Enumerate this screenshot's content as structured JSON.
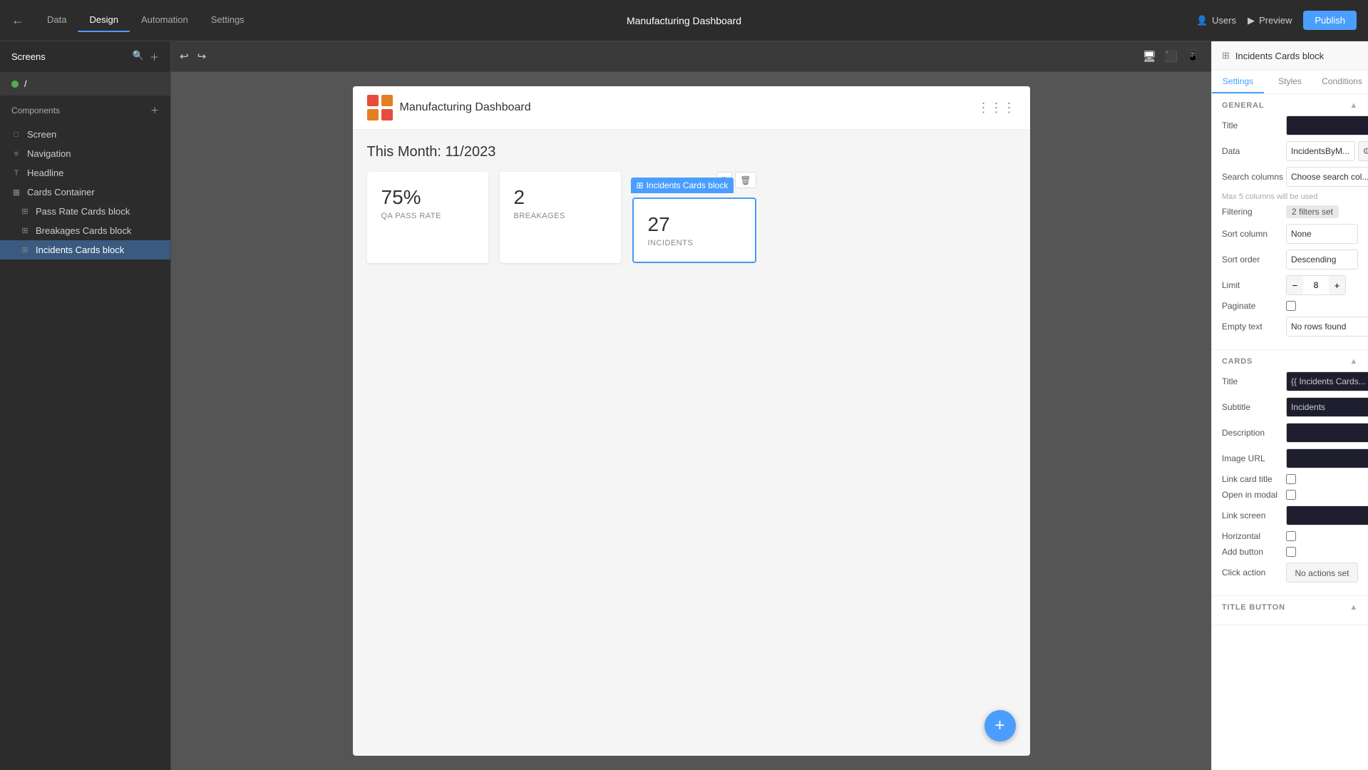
{
  "topNav": {
    "backLabel": "←",
    "tabs": [
      "Data",
      "Design",
      "Automation",
      "Settings"
    ],
    "activeTab": "Design",
    "appTitle": "Manufacturing Dashboard",
    "rightActions": {
      "users": "Users",
      "preview": "Preview",
      "publish": "Publish"
    }
  },
  "leftSidebar": {
    "screensLabel": "Screens",
    "screensItem": "/",
    "componentsLabel": "Components",
    "components": [
      {
        "id": "screen",
        "label": "Screen",
        "indent": 0,
        "icon": "□"
      },
      {
        "id": "navigation",
        "label": "Navigation",
        "indent": 0,
        "icon": "≡"
      },
      {
        "id": "headline",
        "label": "Headline",
        "indent": 0,
        "icon": "T"
      },
      {
        "id": "cards-container",
        "label": "Cards Container",
        "indent": 0,
        "icon": "▦"
      },
      {
        "id": "pass-rate-cards",
        "label": "Pass Rate Cards block",
        "indent": 1,
        "icon": "⊞"
      },
      {
        "id": "breakages-cards",
        "label": "Breakages Cards block",
        "indent": 1,
        "icon": "⊞"
      },
      {
        "id": "incidents-cards",
        "label": "Incidents Cards block",
        "indent": 1,
        "icon": "⊞",
        "active": true
      }
    ]
  },
  "canvasToolbar": {
    "undoLabel": "↩",
    "redoLabel": "↪",
    "desktopIcon": "🖥",
    "tabletIcon": "⬜",
    "mobileIcon": "📱"
  },
  "canvas": {
    "logoAlt": "App Logo",
    "appName": "Manufacturing Dashboard",
    "monthTitle": "This Month: 11/2023",
    "cards": [
      {
        "value": "75%",
        "label": "QA PASS RATE"
      },
      {
        "value": "2",
        "label": "BREAKAGES"
      },
      {
        "value": "27",
        "label": "INCIDENTS",
        "selected": true
      }
    ],
    "selectedCardLabel": "Incidents Cards block",
    "fabLabel": "+"
  },
  "rightPanel": {
    "title": "Incidents Cards block",
    "tabs": [
      "Settings",
      "Styles",
      "Conditions"
    ],
    "activeTab": "Settings",
    "general": {
      "sectionLabel": "GENERAL",
      "fields": {
        "title": {
          "label": "Title",
          "value": "",
          "dark": true
        },
        "data": {
          "label": "Data",
          "value": "IncidentsByM...",
          "hasGear": true
        },
        "searchColumns": {
          "label": "Search columns",
          "value": "Choose search col...",
          "maxNote": "Max 5 columns will be used"
        },
        "filtering": {
          "label": "Filtering",
          "value": "2 filters set"
        },
        "sortColumn": {
          "label": "Sort column",
          "value": "None"
        },
        "sortOrder": {
          "label": "Sort order",
          "value": "Descending"
        },
        "limit": {
          "label": "Limit",
          "value": "8"
        },
        "paginate": {
          "label": "Paginate",
          "checked": false
        },
        "emptyText": {
          "label": "Empty text",
          "value": "No rows found"
        }
      }
    },
    "cards": {
      "sectionLabel": "CARDS",
      "fields": {
        "title": {
          "label": "Title",
          "value": "{{ Incidents Cards..."
        },
        "subtitle": {
          "label": "Subtitle",
          "value": "Incidents"
        },
        "description": {
          "label": "Description",
          "value": ""
        },
        "imageUrl": {
          "label": "Image URL",
          "value": ""
        },
        "linkCardTitle": {
          "label": "Link card title",
          "checked": false
        },
        "openInModal": {
          "label": "Open in modal",
          "checked": false
        },
        "linkScreen": {
          "label": "Link screen",
          "value": ""
        },
        "horizontal": {
          "label": "Horizontal",
          "checked": false
        },
        "addButton": {
          "label": "Add button",
          "checked": false
        },
        "clickAction": {
          "label": "Click action",
          "value": "No actions set"
        }
      }
    },
    "titleButton": {
      "sectionLabel": "TITLE BUTTON"
    }
  }
}
